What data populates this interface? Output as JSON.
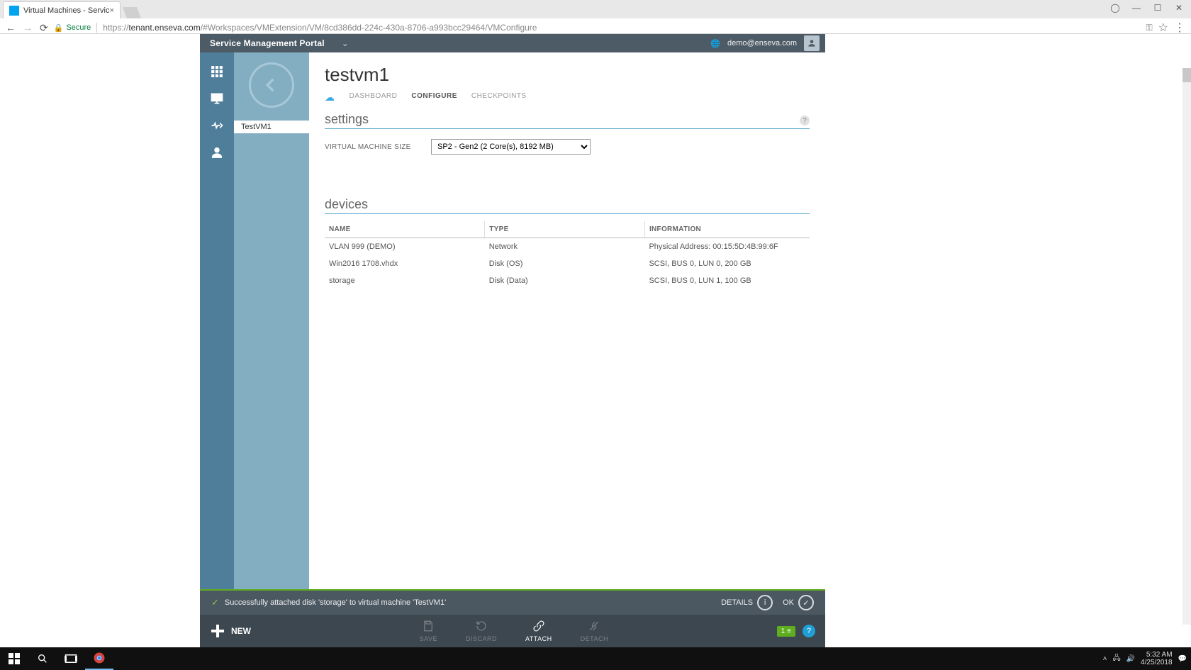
{
  "browser": {
    "tab_title": "Virtual Machines - Servic",
    "secure_label": "Secure",
    "url_prefix": "https://",
    "url_host": "tenant.enseva.com",
    "url_path": "/#Workspaces/VMExtension/VM/8cd386dd-224c-430a-8706-a993bcc29464/VMConfigure"
  },
  "header": {
    "title": "Service Management Portal",
    "user": "demo@enseva.com"
  },
  "side_panel": {
    "selected_item": "TestVM1"
  },
  "page_title": "testvm1",
  "tabs": {
    "dashboard": "DASHBOARD",
    "configure": "CONFIGURE",
    "checkpoints": "CHECKPOINTS"
  },
  "sections": {
    "settings_title": "settings",
    "devices_title": "devices"
  },
  "settings": {
    "vm_size_label": "VIRTUAL MACHINE SIZE",
    "vm_size_value": "SP2 - Gen2 (2 Core(s), 8192 MB)"
  },
  "devices_table": {
    "columns": {
      "name": "NAME",
      "type": "TYPE",
      "info": "INFORMATION"
    },
    "rows": [
      {
        "name": "VLAN 999 (DEMO)",
        "type": "Network",
        "info": "Physical Address: 00:15:5D:4B:99:6F"
      },
      {
        "name": "Win2016 1708.vhdx",
        "type": "Disk (OS)",
        "info": "SCSI, BUS 0, LUN 0, 200 GB"
      },
      {
        "name": "storage",
        "type": "Disk (Data)",
        "info": "SCSI, BUS 0, LUN 1, 100 GB"
      }
    ]
  },
  "status": {
    "message": "Successfully attached disk 'storage' to virtual machine 'TestVM1'",
    "details_label": "DETAILS",
    "ok_label": "OK"
  },
  "commands": {
    "new": "NEW",
    "save": "SAVE",
    "discard": "DISCARD",
    "attach": "ATTACH",
    "detach": "DETACH",
    "count_badge": "1"
  },
  "taskbar": {
    "time": "5:32 AM",
    "date": "4/25/2018"
  }
}
